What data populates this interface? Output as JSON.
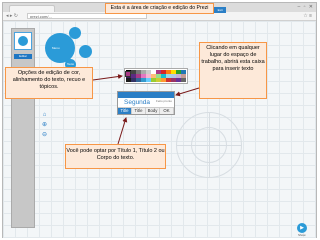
{
  "browser": {
    "window_controls": "– ▫ ✕",
    "nav_arrows": "◂ ▸ ↻",
    "url": "prezi.com/...",
    "addr_icons": "☆ ≡"
  },
  "sidebar": {
    "edit_button": "Editar"
  },
  "bubbles": {
    "label_1": "Menu",
    "label_2": "Texto"
  },
  "top_menu": {
    "items": [
      "Inserir",
      "Frames",
      "Path",
      "Temas",
      "Help",
      "Save",
      "Exit"
    ]
  },
  "annotations": {
    "title": "Esta é a área de criação e edição do Prezi",
    "right": "Clicando em qualquer  lugar do espaço de trabalho, abrirá esta caixa para inserir texto",
    "left": "Opções de edição de cor, alinhamento do texto, recuo e tópicos.",
    "bottom": "Você pode optar por Título 1, Título 2 ou Corpo do texto."
  },
  "editor": {
    "text": "Segunda",
    "hint": "Feito pronto",
    "styles": [
      "Title",
      "Title",
      "Body",
      "OK"
    ],
    "active_style": 0
  },
  "palette": {
    "colors": [
      "#000000",
      "#444444",
      "#777777",
      "#aaaaaa",
      "#cccccc",
      "#ffffff",
      "#a93a85",
      "#d62728",
      "#ff7f0e",
      "#ffdd00",
      "#2ca02c",
      "#1f77b4",
      "#3a1f5d",
      "#5b2c83",
      "#a93a85",
      "#e377c2",
      "#f7b6d2",
      "#ffbb78",
      "#98df8a",
      "#17becf",
      "#9edae5",
      "#aec7e8",
      "#c5b0d5",
      "#c49c94",
      "#1a1a1a",
      "#333366",
      "#336699",
      "#3399cc",
      "#66ccff",
      "#99cc33",
      "#cccc33",
      "#ff9933",
      "#cc3333",
      "#993366",
      "#663399",
      "#666666"
    ]
  },
  "tools": {
    "home_icon": "⌂",
    "zoom_in_icon": "⊕",
    "zoom_out_icon": "⊖"
  },
  "player": {
    "icon": "▶",
    "label": "Show"
  },
  "colors": {
    "note_bg": "#fde9d9",
    "note_border": "#f79646",
    "accent": "#2b7fc6",
    "bubble": "#2b9bd8"
  }
}
